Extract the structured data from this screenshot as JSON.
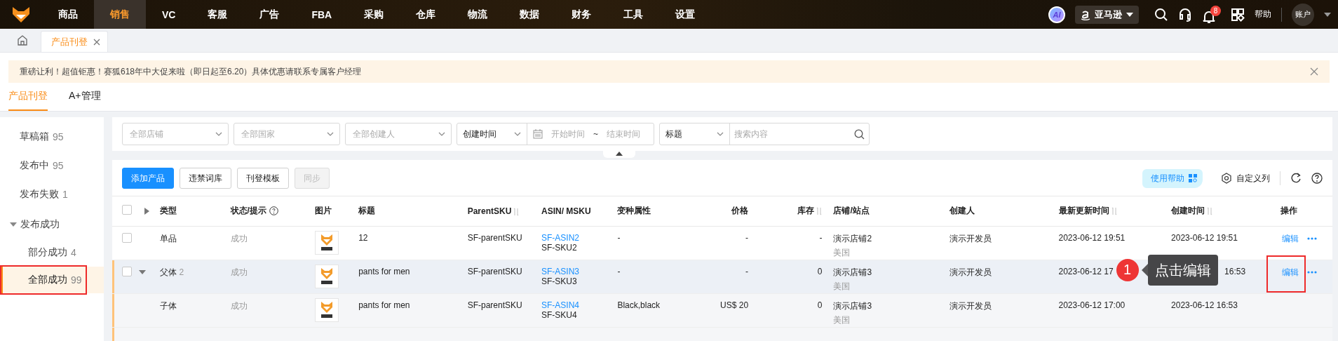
{
  "top_nav": {
    "items": [
      {
        "label": "商品",
        "selected": false
      },
      {
        "label": "销售",
        "selected": true
      },
      {
        "label": "VC",
        "selected": false
      },
      {
        "label": "客服",
        "selected": false
      },
      {
        "label": "广告",
        "selected": false
      },
      {
        "label": "FBA",
        "selected": false
      },
      {
        "label": "采购",
        "selected": false
      },
      {
        "label": "仓库",
        "selected": false
      },
      {
        "label": "物流",
        "selected": false
      },
      {
        "label": "数据",
        "selected": false
      },
      {
        "label": "财务",
        "selected": false
      },
      {
        "label": "工具",
        "selected": false
      },
      {
        "label": "设置",
        "selected": false
      }
    ],
    "ai_badge": "AI",
    "platform": "亚马逊",
    "notification_count": "8",
    "help": "帮助",
    "account": "账户"
  },
  "page_tabs": [
    {
      "label": "产品刊登",
      "selected": true
    }
  ],
  "notice": "重磅让利！超值钜惠！赛狐618年中大促来啦（即日起至6.20）具体优惠请联系专属客户经理",
  "sub_tabs": [
    {
      "label": "产品刊登",
      "selected": true
    },
    {
      "label": "A+管理",
      "selected": false
    }
  ],
  "sidebar": {
    "items": [
      {
        "label": "草稿箱",
        "count": "95",
        "selected": false
      },
      {
        "label": "发布中",
        "count": "95",
        "selected": false
      },
      {
        "label": "发布失败",
        "count": "1",
        "selected": false
      },
      {
        "label": "发布成功",
        "expanded": true,
        "selected": false,
        "children": [
          {
            "label": "部分成功",
            "count": "4",
            "selected": false
          },
          {
            "label": "全部成功",
            "count": "99",
            "selected": true,
            "annotated": true
          }
        ]
      }
    ]
  },
  "filters": [
    {
      "kind": "select",
      "placeholder": "全部店铺"
    },
    {
      "kind": "select",
      "placeholder": "全部国家"
    },
    {
      "kind": "select",
      "placeholder": "全部创建人"
    },
    {
      "kind": "daterange",
      "value": "创建时间",
      "start_placeholder": "开始时间",
      "separator": "~",
      "end_placeholder": "结束时间"
    },
    {
      "kind": "search",
      "value": "标题",
      "placeholder": "搜索内容"
    }
  ],
  "toolbar": {
    "buttons": [
      {
        "label": "添加产品",
        "kind": "primary",
        "disabled": false
      },
      {
        "label": "违禁词库",
        "kind": "default",
        "disabled": false
      },
      {
        "label": "刊登模板",
        "kind": "default",
        "disabled": false
      },
      {
        "label": "同步",
        "kind": "default",
        "disabled": true
      }
    ],
    "help_button": "使用帮助",
    "columns_button": "自定义列"
  },
  "table": {
    "all_checked": false,
    "columns": [
      {
        "label": "类型"
      },
      {
        "label": "状态/提示",
        "help": true
      },
      {
        "label": "图片"
      },
      {
        "label": "标题"
      },
      {
        "label": "ParentSKU",
        "sortable": true
      },
      {
        "label": "ASIN/ MSKU"
      },
      {
        "label": "变种属性"
      },
      {
        "label": "价格",
        "align_right": true
      },
      {
        "label": "库存",
        "sortable": true,
        "align_right": true
      },
      {
        "label": "店铺/站点"
      },
      {
        "label": "创建人"
      },
      {
        "label": "最新更新时间",
        "sortable": true
      },
      {
        "label": "创建时间",
        "sortable": true
      },
      {
        "label": "操作"
      }
    ],
    "rows": [
      {
        "kind": "single",
        "highlighted": false,
        "checked": false,
        "type": "单品",
        "status": "成功",
        "title": "12",
        "parent_sku": "SF-parentSKU",
        "asin": "SF-ASIN2",
        "msku": "SF-SKU2",
        "variation": "-",
        "price": "-",
        "stock": "-",
        "store": "演示店铺2",
        "site": "美国",
        "creator": "演示开发员",
        "updated": "2023-06-12 19:51",
        "created": "2023-06-12 19:51",
        "action": "编辑",
        "annotated": false
      },
      {
        "kind": "parent",
        "highlighted": true,
        "checked": false,
        "expanded": true,
        "type": "父体",
        "child_count": "2",
        "status": "成功",
        "title": "pants for men",
        "parent_sku": "SF-parentSKU",
        "asin": "SF-ASIN3",
        "msku": "SF-SKU3",
        "variation": "-",
        "price": "-",
        "stock": "0",
        "store": "演示店铺3",
        "site": "美国",
        "creator": "演示开发员",
        "updated": "2023-06-12 17",
        "created": "16:53",
        "action": "编辑",
        "annotated": true,
        "tooltip": {
          "step": "1",
          "text": "点击编辑"
        },
        "children": [
          {
            "kind": "child",
            "type": "子体",
            "status": "成功",
            "title": "pants for men",
            "parent_sku": "SF-parentSKU",
            "asin": "SF-ASIN4",
            "msku": "SF-SKU4",
            "variation": "Black,black",
            "price": "US$ 20",
            "stock": "0",
            "store": "演示店铺3",
            "site": "美国",
            "creator": "演示开发员",
            "updated": "2023-06-12 17:00",
            "created": "2023-06-12 16:53"
          }
        ]
      }
    ]
  }
}
